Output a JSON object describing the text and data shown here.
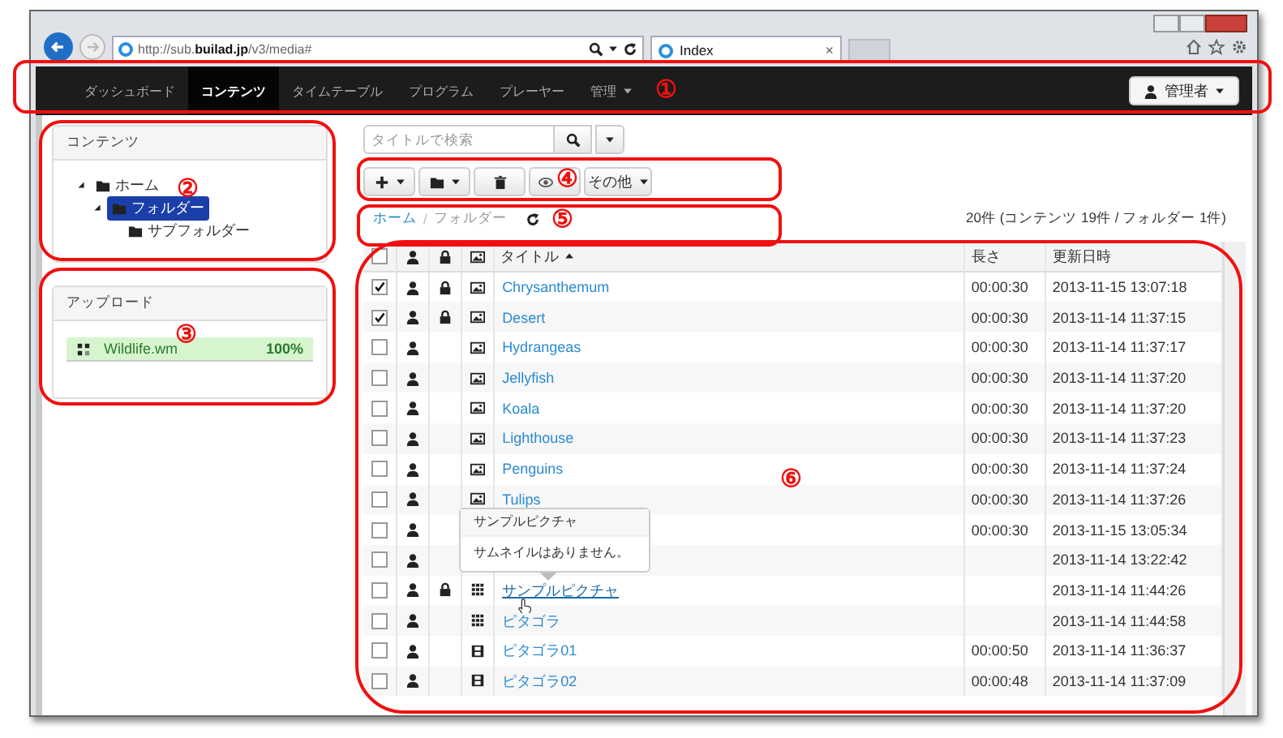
{
  "browser": {
    "url": "http://sub.**builad.jp**/v3/media#",
    "tab": "Index",
    "tab_close": "×"
  },
  "navbar": {
    "items": [
      {
        "label": "ダッシュボード",
        "selected": false,
        "dropdown": false
      },
      {
        "label": "コンテンツ",
        "selected": true,
        "dropdown": false
      },
      {
        "label": "タイムテーブル",
        "selected": false,
        "dropdown": false
      },
      {
        "label": "プログラム",
        "selected": false,
        "dropdown": false
      },
      {
        "label": "プレーヤー",
        "selected": false,
        "dropdown": false
      },
      {
        "label": "管理",
        "selected": false,
        "dropdown": true
      }
    ],
    "user_menu": "管理者"
  },
  "sidebar": {
    "contents_panel": {
      "title": "コンテンツ",
      "tree": [
        {
          "label": "ホーム",
          "expanded": true,
          "selected": false,
          "children": [
            {
              "label": "フォルダー",
              "expanded": true,
              "selected": true,
              "children": [
                {
                  "label": "サブフォルダー",
                  "selected": false
                }
              ]
            }
          ]
        }
      ]
    },
    "upload_panel": {
      "title": "アップロード",
      "items": [
        {
          "name": "Wildlife.wm",
          "percent": "100%",
          "level": 1.0
        }
      ]
    }
  },
  "search": {
    "placeholder": "タイトルで検索"
  },
  "toolbar": {
    "buttons": [
      {
        "kind": "add"
      },
      {
        "kind": "folder"
      },
      {
        "kind": "delete"
      },
      {
        "kind": "view"
      },
      {
        "kind": "more",
        "label": "その他"
      }
    ]
  },
  "breadcrumb": {
    "items": [
      {
        "label": "ホーム",
        "selected": false
      },
      {
        "label": "フォルダー",
        "selected": true
      }
    ],
    "separator": "/",
    "summary": "20件 (コンテンツ 19件 / フォルダー 1件)"
  },
  "table": {
    "select_all": {
      "checked": false
    },
    "columns": [
      "タイトル",
      "長さ",
      "更新日時"
    ],
    "rows": [
      {
        "checked": true,
        "locked": true,
        "kind": "image",
        "title": "Chrysanthemum",
        "length": "00:00:30",
        "updated": "2013-11-15 13:07:18",
        "hovered": false
      },
      {
        "checked": true,
        "locked": true,
        "kind": "image",
        "title": "Desert",
        "length": "00:00:30",
        "updated": "2013-11-14 11:37:15",
        "hovered": false
      },
      {
        "checked": false,
        "locked": false,
        "kind": "image",
        "title": "Hydrangeas",
        "length": "00:00:30",
        "updated": "2013-11-14 11:37:17",
        "hovered": false
      },
      {
        "checked": false,
        "locked": false,
        "kind": "image",
        "title": "Jellyfish",
        "length": "00:00:30",
        "updated": "2013-11-14 11:37:20",
        "hovered": false
      },
      {
        "checked": false,
        "locked": false,
        "kind": "image",
        "title": "Koala",
        "length": "00:00:30",
        "updated": "2013-11-14 11:37:20",
        "hovered": false
      },
      {
        "checked": false,
        "locked": false,
        "kind": "image",
        "title": "Lighthouse",
        "length": "00:00:30",
        "updated": "2013-11-14 11:37:23",
        "hovered": false
      },
      {
        "checked": false,
        "locked": false,
        "kind": "image",
        "title": "Penguins",
        "length": "00:00:30",
        "updated": "2013-11-14 11:37:24",
        "hovered": false
      },
      {
        "checked": false,
        "locked": false,
        "kind": "image",
        "title": "Tulips",
        "length": "00:00:30",
        "updated": "2013-11-14 11:37:26",
        "hovered": false
      },
      {
        "checked": false,
        "locked": false,
        "length": "00:00:30",
        "updated": "2013-11-15 13:05:34"
      },
      {
        "checked": false,
        "locked": false,
        "updated": "2013-11-14 13:22:42"
      },
      {
        "checked": false,
        "locked": true,
        "kind": "list",
        "title": "サンプルピクチャ",
        "updated": "2013-11-14 11:44:26",
        "hovered": true
      },
      {
        "checked": false,
        "locked": false,
        "kind": "list",
        "title": "ピタゴラ",
        "updated": "2013-11-14 11:44:58",
        "hovered": false
      },
      {
        "checked": false,
        "locked": false,
        "kind": "video",
        "title": "ピタゴラ01",
        "length": "00:00:50",
        "updated": "2013-11-14 11:36:37",
        "hovered": false
      },
      {
        "checked": false,
        "locked": false,
        "kind": "video",
        "title": "ピタゴラ02",
        "length": "00:00:48",
        "updated": "2013-11-14 11:37:09",
        "hovered": false
      }
    ]
  },
  "popover": {
    "title": "サンプルピクチャ",
    "body": "サムネイルはありません。"
  },
  "annotations": [
    {
      "label": "①"
    },
    {
      "label": "②"
    },
    {
      "label": "③"
    },
    {
      "label": "④"
    },
    {
      "label": "⑤"
    },
    {
      "label": "⑥"
    }
  ]
}
